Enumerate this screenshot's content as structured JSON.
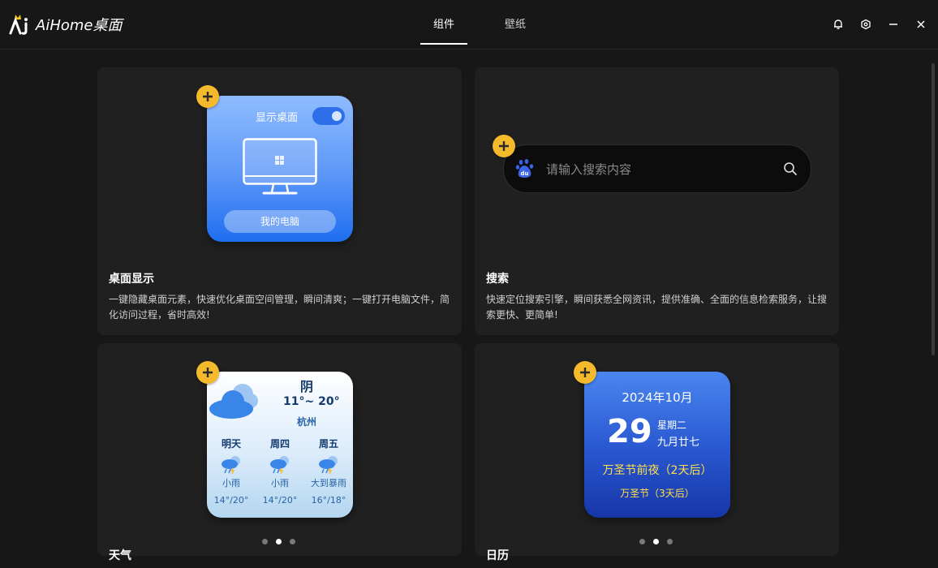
{
  "app": {
    "name": "AiHome桌面"
  },
  "tabs": [
    {
      "label": "组件",
      "active": true
    },
    {
      "label": "壁纸",
      "active": false
    }
  ],
  "window_controls": [
    "bell-icon",
    "settings-icon",
    "minimize-icon",
    "close-icon"
  ],
  "cards": {
    "desktop": {
      "title": "桌面显示",
      "desc": "一键隐藏桌面元素，快速优化桌面空间管理，瞬间清爽；一键打开电脑文件，简化访问过程，省时高效!",
      "widget": {
        "label": "显示桌面",
        "toggle_on": true,
        "button": "我的电脑"
      }
    },
    "search": {
      "title": "搜索",
      "desc": "快速定位搜索引擎，瞬间获悉全网资讯，提供准确、全面的信息检索服务，让搜索更快、更简单!",
      "widget": {
        "placeholder": "请输入搜索内容",
        "engine_icon": "baidu-paw-icon"
      }
    },
    "weather": {
      "title": "天气",
      "widget": {
        "condition": "阴",
        "range": "11°~ 20°",
        "city": "杭州",
        "forecast": [
          {
            "day": "明天",
            "desc": "小雨",
            "temp": "14°/20°"
          },
          {
            "day": "周四",
            "desc": "小雨",
            "temp": "14°/20°"
          },
          {
            "day": "周五",
            "desc": "大到暴雨",
            "temp": "16°/18°"
          }
        ]
      },
      "pager": {
        "count": 3,
        "active": 1
      }
    },
    "calendar": {
      "title": "日历",
      "widget": {
        "year_month": "2024年10月",
        "day": "29",
        "weekday": "星期二",
        "lunar": "九月廿七",
        "event1": "万圣节前夜（2天后）",
        "event2": "万圣节（3天后）"
      },
      "pager": {
        "count": 3,
        "active": 1
      }
    }
  },
  "colors": {
    "accent": "#f5b92c",
    "background": "#171717",
    "card": "#202020"
  }
}
